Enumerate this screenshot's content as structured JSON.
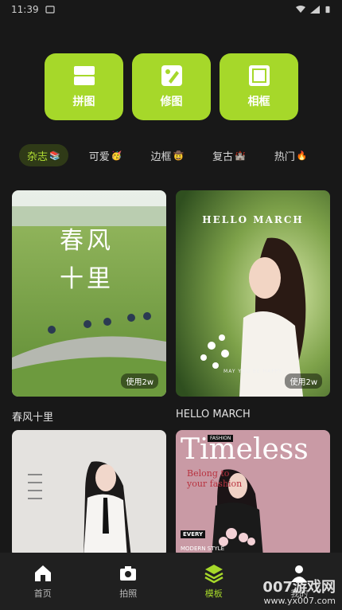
{
  "status_bar": {
    "time": "11:39"
  },
  "tools": [
    {
      "label": "拼图",
      "icon": "collage-icon"
    },
    {
      "label": "修图",
      "icon": "edit-photo-icon"
    },
    {
      "label": "相框",
      "icon": "frame-icon"
    }
  ],
  "tabs": [
    {
      "label": "杂志",
      "emoji": "📚"
    },
    {
      "label": "可爱",
      "emoji": "🥳"
    },
    {
      "label": "边框",
      "emoji": "🤠"
    },
    {
      "label": "复古",
      "emoji": "🏰"
    },
    {
      "label": "热门",
      "emoji": "🔥"
    }
  ],
  "cards": [
    {
      "title": "春风十里",
      "usage": "使用2w",
      "overlay": "春风十里"
    },
    {
      "title": "HELLO MARCH",
      "usage": "使用2w",
      "overlay": "HELLO MARCH",
      "caption": "MAY YOU BE HAPPY"
    },
    {
      "title": "",
      "usage": "",
      "overlay": ""
    },
    {
      "title": "",
      "usage": "",
      "overlay": "Timeless",
      "subtitle": "Belong to your fashion",
      "tag1": "EVERY",
      "tag2": "MODERN STYLE",
      "fashion": "FASHION"
    }
  ],
  "bottom_nav": [
    {
      "label": "首页",
      "icon": "home-icon"
    },
    {
      "label": "拍照",
      "icon": "camera-icon"
    },
    {
      "label": "模板",
      "icon": "layers-icon"
    },
    {
      "label": "我的",
      "icon": "profile-icon"
    }
  ],
  "watermark": {
    "main": "007游戏网",
    "sub": "www.yx007.com"
  },
  "colors": {
    "accent": "#a6d82a",
    "background": "#181818"
  }
}
